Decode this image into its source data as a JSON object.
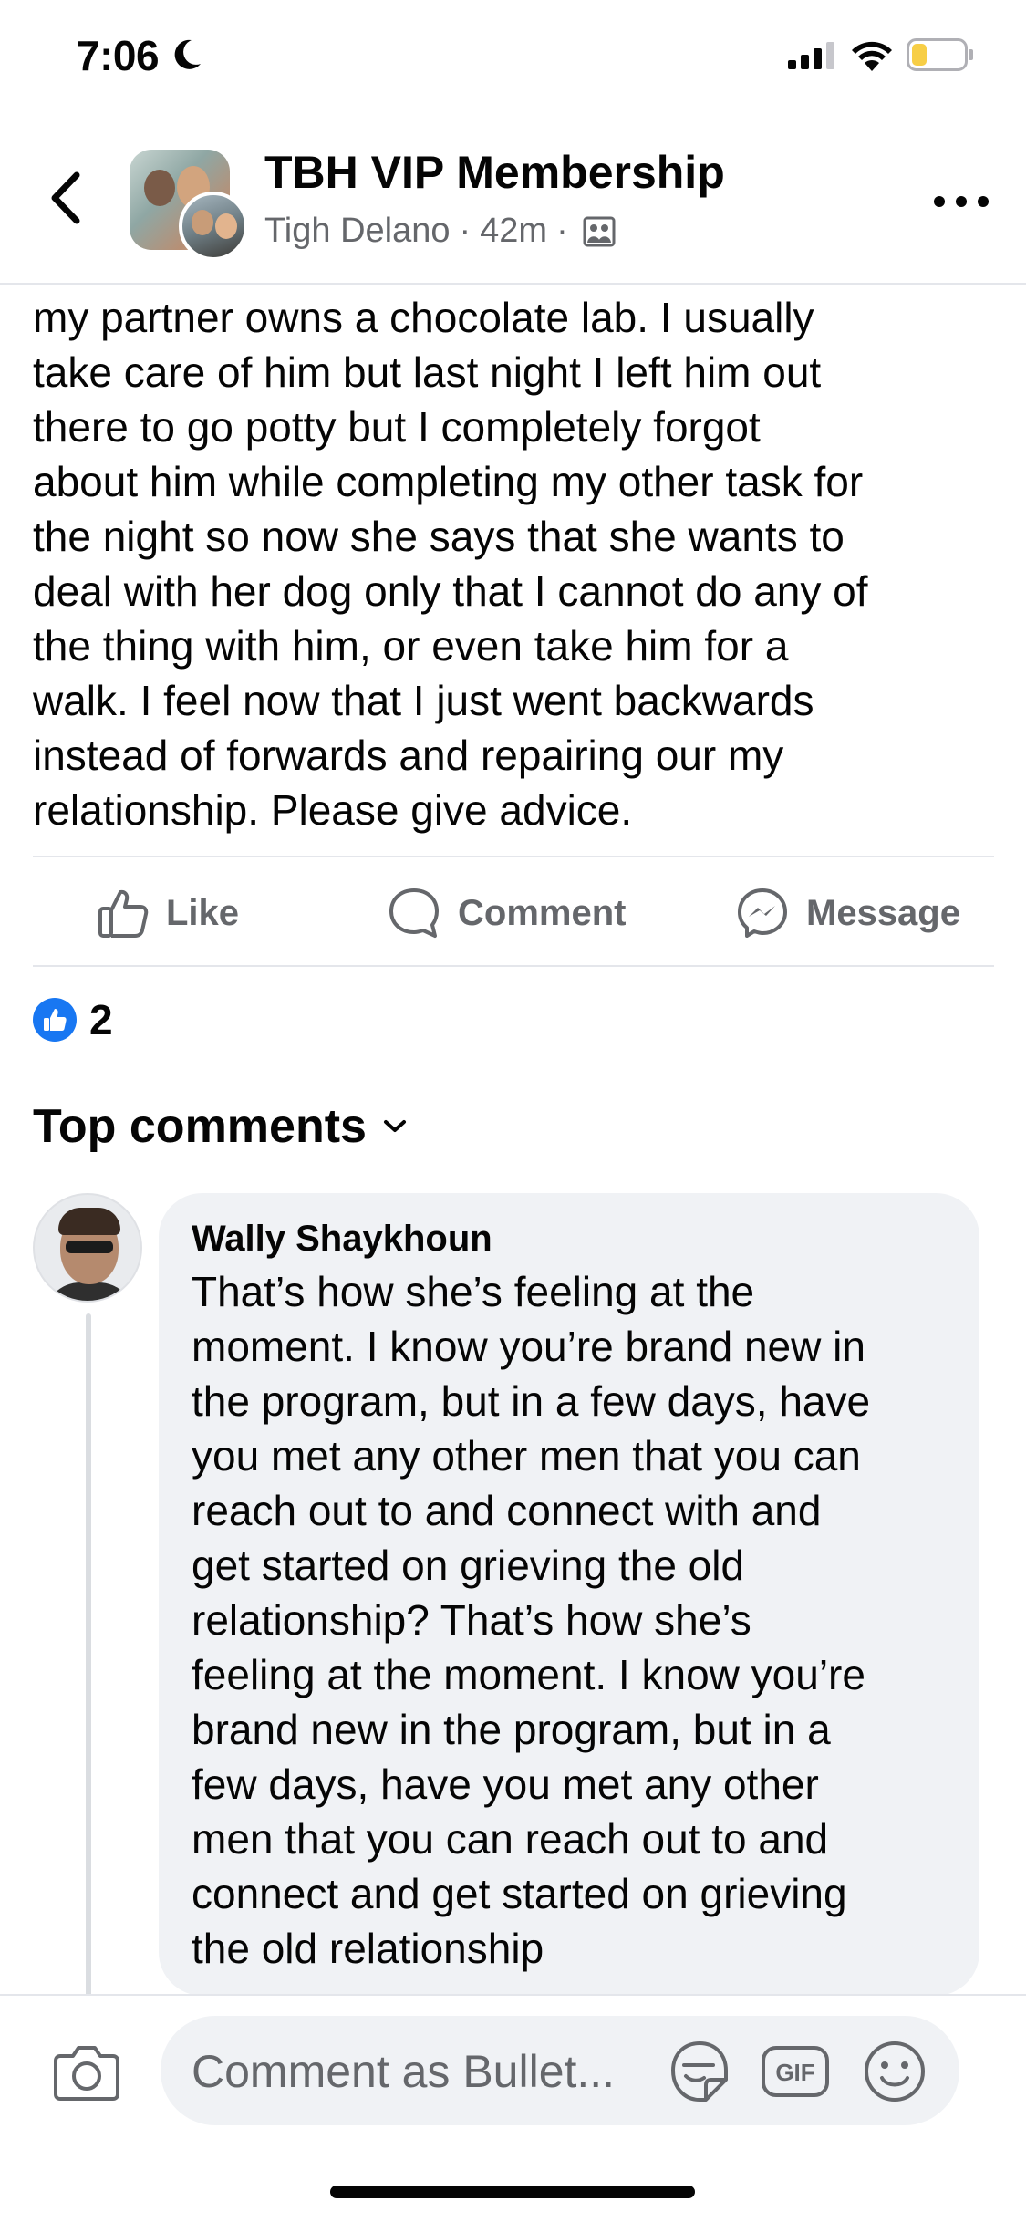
{
  "status_bar": {
    "time": "7:06",
    "icons": [
      "moon-icon",
      "signal-icon",
      "wifi-icon",
      "battery-icon"
    ]
  },
  "header": {
    "group_title": "TBH VIP Membership",
    "author": "Tigh Delano",
    "separator": "·",
    "time_ago": "42m",
    "privacy_icon": "group-members-icon"
  },
  "post": {
    "text": " my partner owns a chocolate lab. I usually\ntake care of him but last night I left him out\nthere to go potty but I completely forgot\nabout him while completing my other task for\nthe night so now she says that she wants to\ndeal with her dog only that I cannot do any of\nthe thing with him, or even take him for a\nwalk. I feel now that I just went backwards\ninstead of forwards and repairing our my\nrelationship. Please give advice."
  },
  "actions": {
    "like_label": "Like",
    "comment_label": "Comment",
    "message_label": "Message"
  },
  "reactions": {
    "count": "2"
  },
  "comments_section": {
    "heading": "Top comments"
  },
  "comment": {
    "author": "Wally Shaykhoun",
    "text": "That’s how she’s feeling at the\nmoment. I know you’re brand new in\nthe program, but in a few days, have\nyou met any other men that you can\nreach out to and connect with and\nget started on grieving the old\nrelationship? That’s how she’s\nfeeling at the moment. I know you’re\nbrand new in the program, but in a\nfew days, have you met any other\nmen that you can reach out to and\nconnect and get started on grieving\nthe old relationship"
  },
  "composer": {
    "placeholder": "Comment as Bullet...",
    "gif_label": "GIF"
  },
  "colors": {
    "accent": "#1877f2",
    "secondary_text": "#65676b",
    "bubble": "#f0f2f5",
    "divider": "#e4e6eb"
  }
}
